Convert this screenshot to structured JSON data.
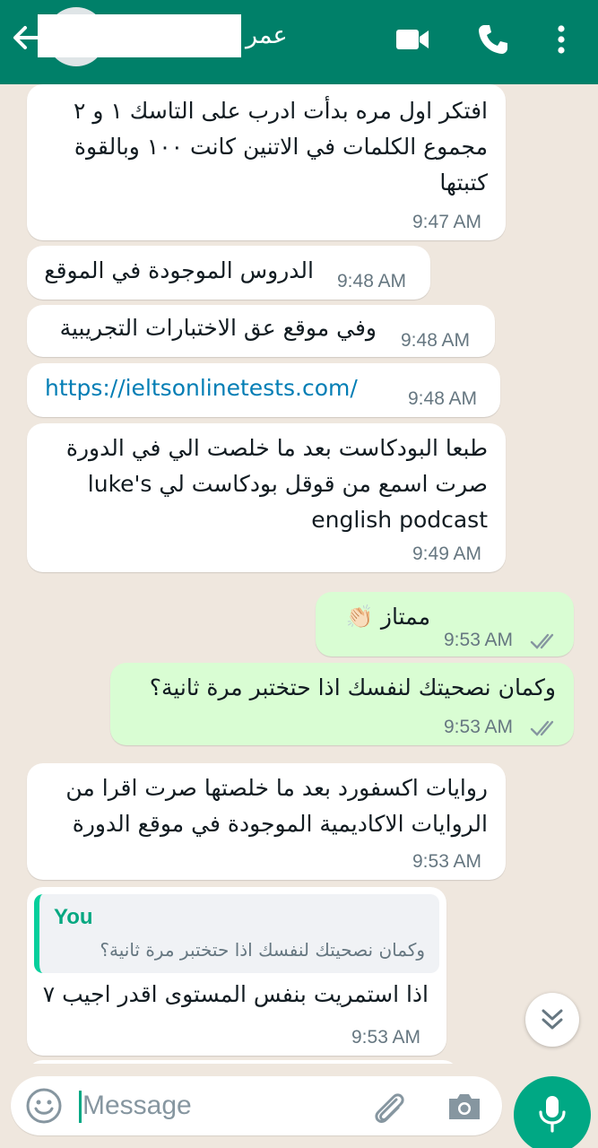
{
  "header": {
    "contact_name": "عمر",
    "back_icon": "arrow-left-icon",
    "video_icon": "video-camera-icon",
    "call_icon": "phone-icon",
    "more_icon": "more-vertical-icon",
    "color": "#008069"
  },
  "messages": [
    {
      "dir": "in",
      "lines": [
        "افتكر اول مره بدأت ادرب على التاسك ١ و ٢",
        "مجموع الكلمات في الاتنين كانت ١٠٠ وبالقوة",
        "كتبتها"
      ],
      "time": "9:47 AM"
    },
    {
      "dir": "in",
      "lines": [
        "الدروس الموجودة في الموقع"
      ],
      "time": "9:48 AM"
    },
    {
      "dir": "in",
      "lines": [
        "وفي موقع عق الاختبارات التجريبية"
      ],
      "time": "9:48 AM"
    },
    {
      "dir": "in",
      "lines": [
        "https://ieltsonlinetests.com/"
      ],
      "time": "9:48 AM"
    },
    {
      "dir": "in",
      "lines": [
        "طبعا البودكاست بعد ما خلصت الي في الدورة",
        "صرت اسمع من قوقل بودكاست لي luke's",
        "english podcast"
      ],
      "time": "9:49 AM"
    },
    {
      "dir": "out",
      "lines": [
        "ممتاز 👏🏻"
      ],
      "time": "9:53 AM",
      "status": "read"
    },
    {
      "dir": "out",
      "lines": [
        "وكمان نصحيتك لنفسك اذا حتختبر مرة ثانية؟"
      ],
      "time": "9:53 AM",
      "status": "read"
    },
    {
      "dir": "in",
      "lines": [
        "روايات اكسفورد بعد ما خلصتها صرت اقرا من",
        "الروايات الاكاديمية الموجودة في موقع الدورة"
      ],
      "time": "9:53 AM"
    },
    {
      "dir": "in",
      "reply_to": {
        "name": "You",
        "text": "وكمان نصحيتك لنفسك اذا حتختبر مرة ثانية؟"
      },
      "lines": [
        "اذا استمريت بنفس المستوى اقدر اجيب ٧"
      ],
      "time": "9:53 AM"
    }
  ],
  "composer": {
    "placeholder": "Message",
    "emoji_icon": "smiley-icon",
    "attach_icon": "paperclip-icon",
    "camera_icon": "camera-icon",
    "mic_icon": "microphone-icon",
    "accent": "#00a884"
  },
  "scroll_down_icon": "chevron-double-down-icon"
}
